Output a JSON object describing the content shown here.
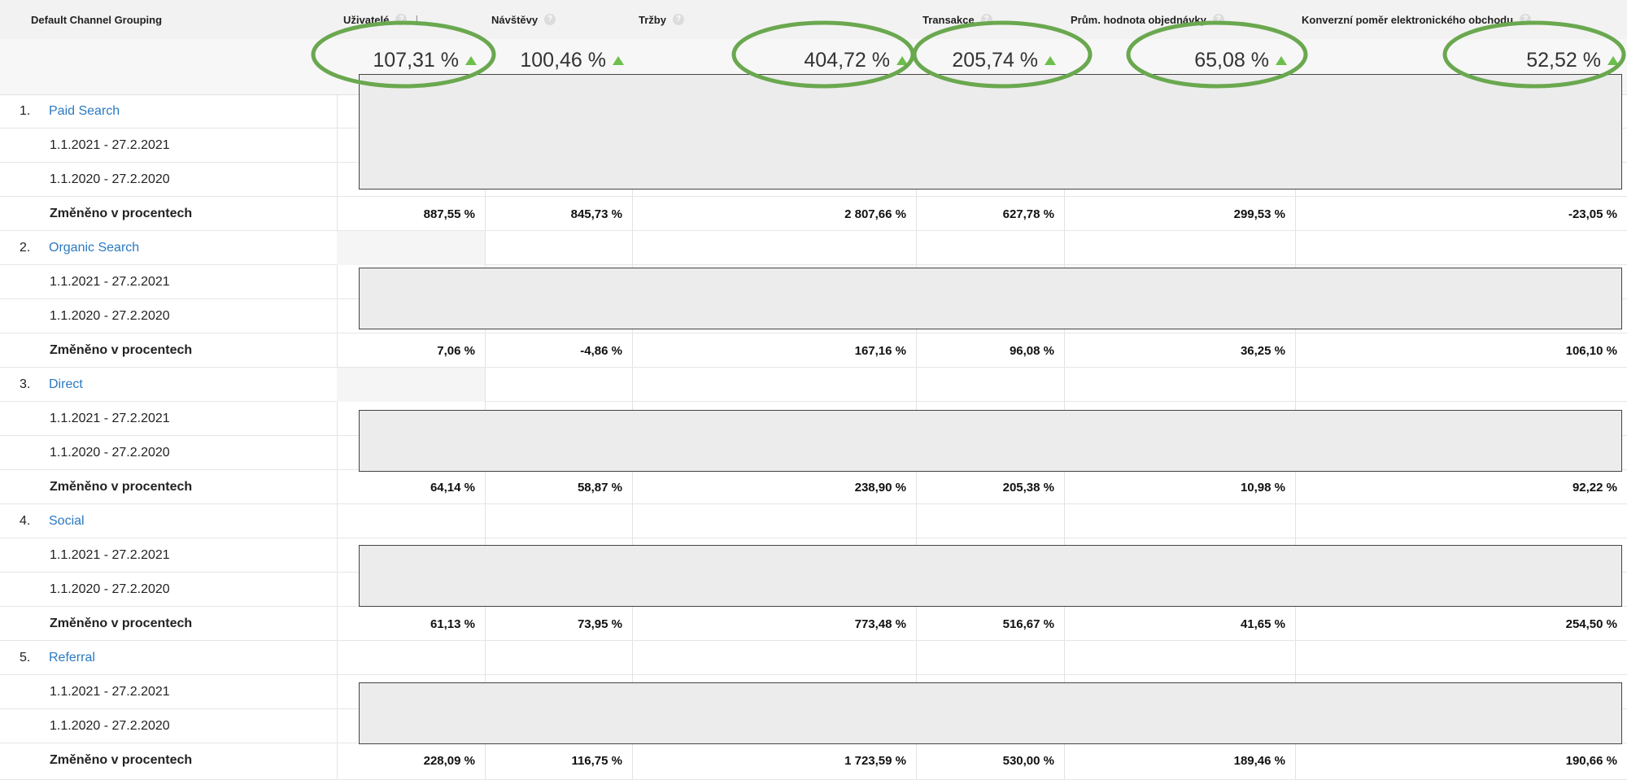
{
  "header": {
    "dimension": "Default Channel Grouping",
    "columns": [
      {
        "label": "Uživatelé",
        "sorted": true
      },
      {
        "label": "Návštěvy"
      },
      {
        "label": "Tržby"
      },
      {
        "label": "Transakce"
      },
      {
        "label": "Prům. hodnota objednávky"
      },
      {
        "label": "Konverzní poměr elektronického obchodu"
      }
    ]
  },
  "totals": [
    "107,31 %",
    "100,46 %",
    "404,72 %",
    "205,74 %",
    "65,08 %",
    "52,52 %"
  ],
  "channels": [
    {
      "num": "1.",
      "name": "Paid Search",
      "date1": "1.1.2021 - 27.2.2021",
      "date2": "1.1.2020 - 27.2.2020",
      "change_label": "Změněno v procentech",
      "changes": [
        "887,55 %",
        "845,73 %",
        "2 807,66 %",
        "627,78 %",
        "299,53 %",
        "-23,05 %"
      ]
    },
    {
      "num": "2.",
      "name": "Organic Search",
      "date1": "1.1.2021 - 27.2.2021",
      "date2": "1.1.2020 - 27.2.2020",
      "change_label": "Změněno v procentech",
      "changes": [
        "7,06 %",
        "-4,86 %",
        "167,16 %",
        "96,08 %",
        "36,25 %",
        "106,10 %"
      ]
    },
    {
      "num": "3.",
      "name": "Direct",
      "date1": "1.1.2021 - 27.2.2021",
      "date2": "1.1.2020 - 27.2.2020",
      "change_label": "Změněno v procentech",
      "changes": [
        "64,14 %",
        "58,87 %",
        "238,90 %",
        "205,38 %",
        "10,98 %",
        "92,22 %"
      ]
    },
    {
      "num": "4.",
      "name": "Social",
      "date1": "1.1.2021 - 27.2.2021",
      "date2": "1.1.2020 - 27.2.2020",
      "change_label": "Změněno v procentech",
      "changes": [
        "61,13 %",
        "73,95 %",
        "773,48 %",
        "516,67 %",
        "41,65 %",
        "254,50 %"
      ]
    },
    {
      "num": "5.",
      "name": "Referral",
      "date1": "1.1.2021 - 27.2.2021",
      "date2": "1.1.2020 - 27.2.2020",
      "change_label": "Změněno v procentech",
      "changes": [
        "228,09 %",
        "116,75 %",
        "1 723,59 %",
        "530,00 %",
        "189,46 %",
        "190,66 %"
      ]
    }
  ],
  "colors": {
    "link": "#2b79c2",
    "up_arrow": "#6cbf4b",
    "highlight_oval": "#6aa84f"
  },
  "icons": {
    "help": "question-circle-icon",
    "sort": "sort-down-arrow-icon",
    "trend": "trend-up-arrow-icon"
  }
}
